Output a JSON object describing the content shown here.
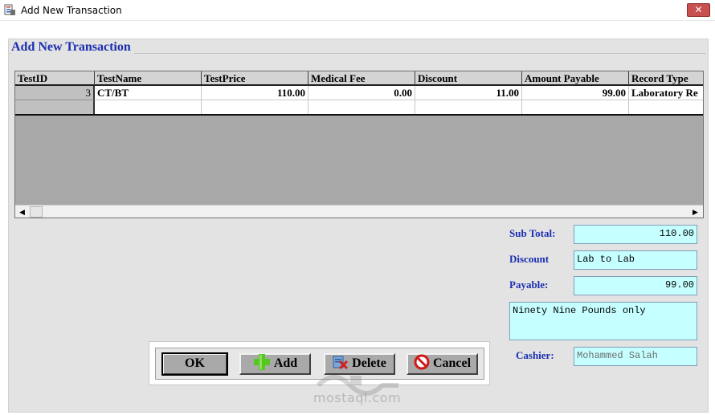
{
  "window": {
    "title": "Add New Transaction",
    "close_glyph": "✕"
  },
  "group": {
    "legend": "Add New Transaction"
  },
  "grid": {
    "columns": [
      "TestID",
      "TestName",
      "TestPrice",
      "Medical Fee",
      "Discount",
      "Amount Payable",
      "Record Type"
    ],
    "rows": [
      {
        "testid": "3",
        "testname": "CT/BT",
        "testprice": "110.00",
        "medical_fee": "0.00",
        "discount": "11.00",
        "amount_payable": "99.00",
        "record_type": "Laboratory Re"
      }
    ],
    "scroll_left_glyph": "◀",
    "scroll_right_glyph": "▶"
  },
  "summary": {
    "subtotal_label": "Sub Total:",
    "subtotal_value": "110.00",
    "discount_label": "Discount",
    "discount_value": "Lab to Lab",
    "payable_label": "Payable:",
    "payable_value": "99.00",
    "amount_words": "Ninety Nine Pounds only",
    "cashier_label": "Cashier:",
    "cashier_value": "Mohammed Salah"
  },
  "buttons": {
    "ok": "OK",
    "add": "Add",
    "delete": "Delete",
    "cancel": "Cancel"
  },
  "watermark": {
    "text": "mostaql.com"
  },
  "colors": {
    "label_blue": "#1a2eb0",
    "field_cyan": "#c6ffff",
    "panel_gray": "#e3e3e3"
  }
}
